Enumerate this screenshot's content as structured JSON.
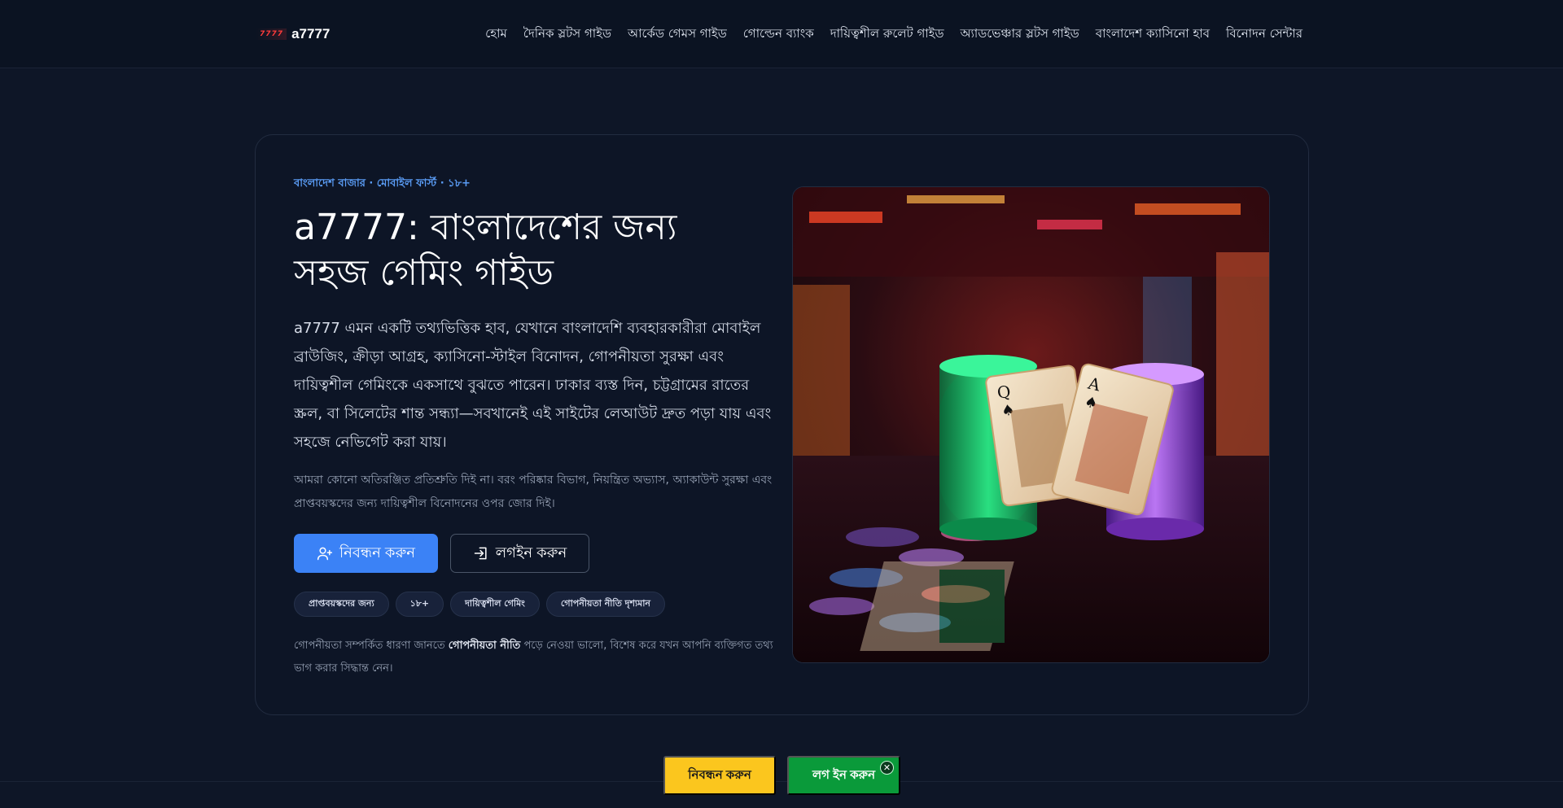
{
  "brand": {
    "logo_text": "7777",
    "name": "a7777"
  },
  "nav": [
    "হোম",
    "দৈনিক স্লটস গাইড",
    "আর্কেড গেমস গাইড",
    "গোল্ডেন ব্যাংক",
    "দায়িত্বশীল রুলেট গাইড",
    "অ্যাডভেঞ্চার স্লটস গাইড",
    "বাংলাদেশ ক্যাসিনো হাব",
    "বিনোদন সেন্টার"
  ],
  "hero": {
    "eyebrow": "বাংলাদেশ বাজার · মোবাইল ফার্স্ট · ১৮+",
    "title": "a7777: বাংলাদেশের জন্য সহজ গেমিং গাইড",
    "lead": "a7777 এমন একটি তথ্যভিত্তিক হাব, যেখানে বাংলাদেশি ব্যবহারকারীরা মোবাইল ব্রাউজিং, ক্রীড়া আগ্রহ, ক্যাসিনো-স্টাইল বিনোদন, গোপনীয়তা সুরক্ষা এবং দায়িত্বশীল গেমিংকে একসাথে বুঝতে পারেন। ঢাকার ব্যস্ত দিন, চট্টগ্রামের রাতের স্ক্রল, বা সিলেটের শান্ত সন্ধ্যা—সবখানেই এই সাইটের লেআউট দ্রুত পড়া যায় এবং সহজে নেভিগেট করা যায়।",
    "note": "আমরা কোনো অতিরঞ্জিত প্রতিশ্রুতি দিই না। বরং পরিষ্কার বিভাগ, নিয়ন্ত্রিত অভ্যাস, অ্যাকাউন্ট সুরক্ষা এবং প্রাপ্তবয়স্কদের জন্য দায়িত্বশীল বিনোদনের ওপর জোর দিই।",
    "register_label": "নিবন্ধন করুন",
    "login_label": "লগইন করুন",
    "tags": [
      "প্রাপ্তবয়স্কদের জন্য",
      "১৮+",
      "দায়িত্বশীল গেমিং",
      "গোপনীয়তা নীতি দৃশ্যমান"
    ],
    "privacy_before": "গোপনীয়তা সম্পর্কিত ধারণা জানতে ",
    "privacy_link": "গোপনীয়তা নীতি",
    "privacy_after": " পড়ে নেওয়া ভালো, বিশেষ করে যখন আপনি ব্যক্তিগত তথ্য ভাগ করার সিদ্ধান্ত নেন।"
  },
  "sticky": {
    "register_label": "নিবন্ধন করুন",
    "login_label": "লগ ইন করুন",
    "close_symbol": "✕"
  },
  "colors": {
    "accent": "#3b82f6",
    "sticky_register": "#fbc61e",
    "sticky_login": "#0a9a3a",
    "background": "#0e1627"
  }
}
